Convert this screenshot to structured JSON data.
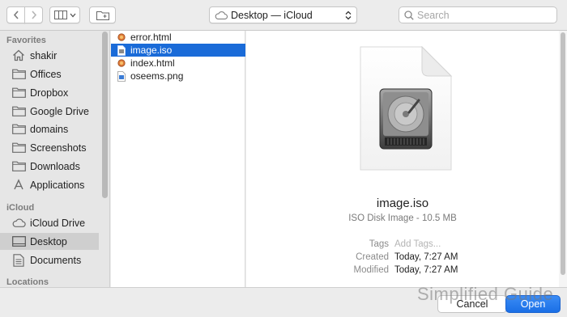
{
  "toolbar": {
    "location_label": "Desktop — iCloud",
    "search_placeholder": "Search"
  },
  "sidebar": {
    "sections": [
      {
        "heading": "Favorites",
        "items": [
          {
            "label": "shakir",
            "icon": "home-icon"
          },
          {
            "label": "Offices",
            "icon": "folder-icon"
          },
          {
            "label": "Dropbox",
            "icon": "folder-icon"
          },
          {
            "label": "Google Drive",
            "icon": "folder-icon"
          },
          {
            "label": "domains",
            "icon": "folder-icon"
          },
          {
            "label": "Screenshots",
            "icon": "folder-icon"
          },
          {
            "label": "Downloads",
            "icon": "folder-icon"
          },
          {
            "label": "Applications",
            "icon": "applications-icon"
          }
        ]
      },
      {
        "heading": "iCloud",
        "items": [
          {
            "label": "iCloud Drive",
            "icon": "cloud-icon"
          },
          {
            "label": "Desktop",
            "icon": "desktop-icon",
            "selected": true
          },
          {
            "label": "Documents",
            "icon": "documents-icon"
          }
        ]
      },
      {
        "heading": "Locations",
        "items": []
      }
    ]
  },
  "files": [
    {
      "name": "error.html",
      "icon": "html-file-icon",
      "selected": false
    },
    {
      "name": "image.iso",
      "icon": "iso-file-icon",
      "selected": true
    },
    {
      "name": "index.html",
      "icon": "html-file-icon",
      "selected": false
    },
    {
      "name": "oseems.png",
      "icon": "png-file-icon",
      "selected": false
    }
  ],
  "preview": {
    "icon": "disk-image-icon",
    "name": "image.iso",
    "kind": "ISO Disk Image - 10.5 MB",
    "tags_label": "Tags",
    "tags_placeholder": "Add Tags...",
    "created_label": "Created",
    "created_value": "Today, 7:27 AM",
    "modified_label": "Modified",
    "modified_value": "Today, 7:27 AM"
  },
  "buttons": {
    "cancel": "Cancel",
    "open": "Open"
  },
  "watermark": "Simplified Guide",
  "colors": {
    "selection": "#1a6bd8",
    "accent": "#1a6fe6"
  }
}
